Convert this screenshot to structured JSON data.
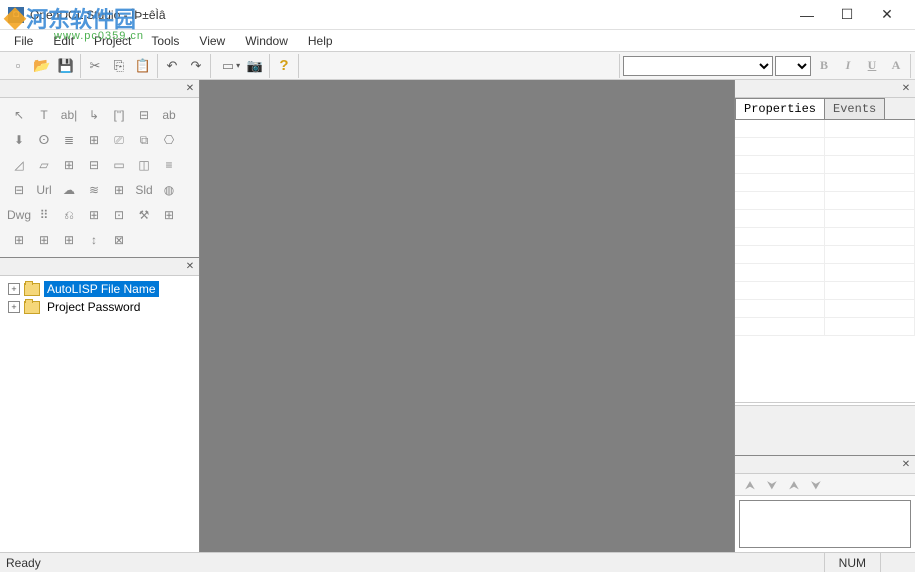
{
  "title": "OpenDCL Studio - ÎÞ±êÌâ",
  "watermark": {
    "brand": "河东软件园",
    "url": "www.pc0359.cn"
  },
  "menu": {
    "file": "File",
    "edit": "Edit",
    "project": "Project",
    "tools": "Tools",
    "view": "View",
    "window": "Window",
    "help": "Help"
  },
  "toolbar": {
    "format": {
      "bold": "B",
      "italic": "I",
      "underline": "U",
      "other": "A"
    }
  },
  "toolbox": {
    "items": [
      "↖",
      "T",
      "ab|",
      "↳",
      "[\"]",
      "⊟",
      "ab",
      "⬇",
      "ⵙ",
      "≣",
      "⊞",
      "⎚",
      "⧉",
      "⎔",
      "◿",
      "▱",
      "⊞",
      "⊟",
      "▭",
      "◫",
      "≡",
      "⊟",
      "Url",
      "☁",
      "≋",
      "⊞",
      "Sld",
      "◍",
      "Dwg",
      "⠿",
      "⎌",
      "⊞",
      "⊡",
      "⚒",
      "⊞",
      "⊞",
      "⊞",
      "⊞",
      "↕",
      "⊠"
    ]
  },
  "tree": {
    "items": [
      {
        "label": "AutoLISP File Name",
        "selected": true
      },
      {
        "label": "Project Password",
        "selected": false
      }
    ]
  },
  "props": {
    "tab1": "Properties",
    "tab2": "Events"
  },
  "zorder": {
    "b1": "⮝",
    "b2": "⮟",
    "b3": "⮝",
    "b4": "⮟"
  },
  "status": {
    "ready": "Ready",
    "num": "NUM"
  }
}
